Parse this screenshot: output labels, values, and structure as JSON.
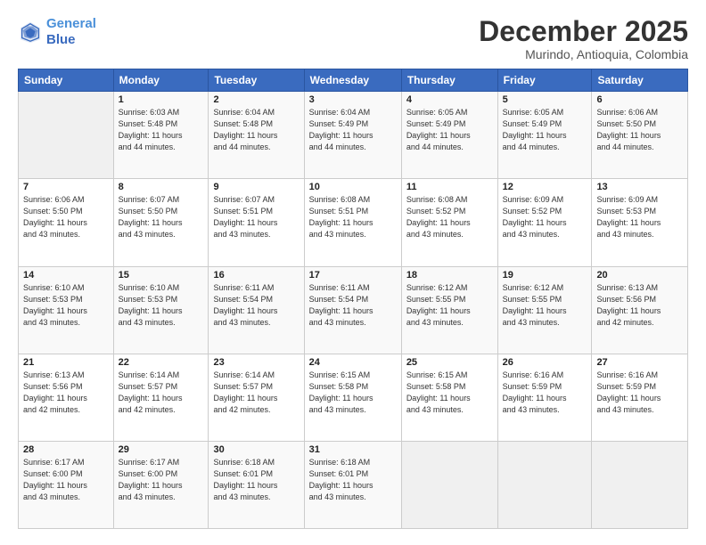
{
  "header": {
    "logo_line1": "General",
    "logo_line2": "Blue",
    "month": "December 2025",
    "location": "Murindo, Antioquia, Colombia"
  },
  "days_of_week": [
    "Sunday",
    "Monday",
    "Tuesday",
    "Wednesday",
    "Thursday",
    "Friday",
    "Saturday"
  ],
  "weeks": [
    [
      {
        "day": "",
        "info": ""
      },
      {
        "day": "1",
        "info": "Sunrise: 6:03 AM\nSunset: 5:48 PM\nDaylight: 11 hours\nand 44 minutes."
      },
      {
        "day": "2",
        "info": "Sunrise: 6:04 AM\nSunset: 5:48 PM\nDaylight: 11 hours\nand 44 minutes."
      },
      {
        "day": "3",
        "info": "Sunrise: 6:04 AM\nSunset: 5:49 PM\nDaylight: 11 hours\nand 44 minutes."
      },
      {
        "day": "4",
        "info": "Sunrise: 6:05 AM\nSunset: 5:49 PM\nDaylight: 11 hours\nand 44 minutes."
      },
      {
        "day": "5",
        "info": "Sunrise: 6:05 AM\nSunset: 5:49 PM\nDaylight: 11 hours\nand 44 minutes."
      },
      {
        "day": "6",
        "info": "Sunrise: 6:06 AM\nSunset: 5:50 PM\nDaylight: 11 hours\nand 44 minutes."
      }
    ],
    [
      {
        "day": "7",
        "info": "Sunrise: 6:06 AM\nSunset: 5:50 PM\nDaylight: 11 hours\nand 43 minutes."
      },
      {
        "day": "8",
        "info": "Sunrise: 6:07 AM\nSunset: 5:50 PM\nDaylight: 11 hours\nand 43 minutes."
      },
      {
        "day": "9",
        "info": "Sunrise: 6:07 AM\nSunset: 5:51 PM\nDaylight: 11 hours\nand 43 minutes."
      },
      {
        "day": "10",
        "info": "Sunrise: 6:08 AM\nSunset: 5:51 PM\nDaylight: 11 hours\nand 43 minutes."
      },
      {
        "day": "11",
        "info": "Sunrise: 6:08 AM\nSunset: 5:52 PM\nDaylight: 11 hours\nand 43 minutes."
      },
      {
        "day": "12",
        "info": "Sunrise: 6:09 AM\nSunset: 5:52 PM\nDaylight: 11 hours\nand 43 minutes."
      },
      {
        "day": "13",
        "info": "Sunrise: 6:09 AM\nSunset: 5:53 PM\nDaylight: 11 hours\nand 43 minutes."
      }
    ],
    [
      {
        "day": "14",
        "info": "Sunrise: 6:10 AM\nSunset: 5:53 PM\nDaylight: 11 hours\nand 43 minutes."
      },
      {
        "day": "15",
        "info": "Sunrise: 6:10 AM\nSunset: 5:53 PM\nDaylight: 11 hours\nand 43 minutes."
      },
      {
        "day": "16",
        "info": "Sunrise: 6:11 AM\nSunset: 5:54 PM\nDaylight: 11 hours\nand 43 minutes."
      },
      {
        "day": "17",
        "info": "Sunrise: 6:11 AM\nSunset: 5:54 PM\nDaylight: 11 hours\nand 43 minutes."
      },
      {
        "day": "18",
        "info": "Sunrise: 6:12 AM\nSunset: 5:55 PM\nDaylight: 11 hours\nand 43 minutes."
      },
      {
        "day": "19",
        "info": "Sunrise: 6:12 AM\nSunset: 5:55 PM\nDaylight: 11 hours\nand 43 minutes."
      },
      {
        "day": "20",
        "info": "Sunrise: 6:13 AM\nSunset: 5:56 PM\nDaylight: 11 hours\nand 42 minutes."
      }
    ],
    [
      {
        "day": "21",
        "info": "Sunrise: 6:13 AM\nSunset: 5:56 PM\nDaylight: 11 hours\nand 42 minutes."
      },
      {
        "day": "22",
        "info": "Sunrise: 6:14 AM\nSunset: 5:57 PM\nDaylight: 11 hours\nand 42 minutes."
      },
      {
        "day": "23",
        "info": "Sunrise: 6:14 AM\nSunset: 5:57 PM\nDaylight: 11 hours\nand 42 minutes."
      },
      {
        "day": "24",
        "info": "Sunrise: 6:15 AM\nSunset: 5:58 PM\nDaylight: 11 hours\nand 43 minutes."
      },
      {
        "day": "25",
        "info": "Sunrise: 6:15 AM\nSunset: 5:58 PM\nDaylight: 11 hours\nand 43 minutes."
      },
      {
        "day": "26",
        "info": "Sunrise: 6:16 AM\nSunset: 5:59 PM\nDaylight: 11 hours\nand 43 minutes."
      },
      {
        "day": "27",
        "info": "Sunrise: 6:16 AM\nSunset: 5:59 PM\nDaylight: 11 hours\nand 43 minutes."
      }
    ],
    [
      {
        "day": "28",
        "info": "Sunrise: 6:17 AM\nSunset: 6:00 PM\nDaylight: 11 hours\nand 43 minutes."
      },
      {
        "day": "29",
        "info": "Sunrise: 6:17 AM\nSunset: 6:00 PM\nDaylight: 11 hours\nand 43 minutes."
      },
      {
        "day": "30",
        "info": "Sunrise: 6:18 AM\nSunset: 6:01 PM\nDaylight: 11 hours\nand 43 minutes."
      },
      {
        "day": "31",
        "info": "Sunrise: 6:18 AM\nSunset: 6:01 PM\nDaylight: 11 hours\nand 43 minutes."
      },
      {
        "day": "",
        "info": ""
      },
      {
        "day": "",
        "info": ""
      },
      {
        "day": "",
        "info": ""
      }
    ]
  ]
}
